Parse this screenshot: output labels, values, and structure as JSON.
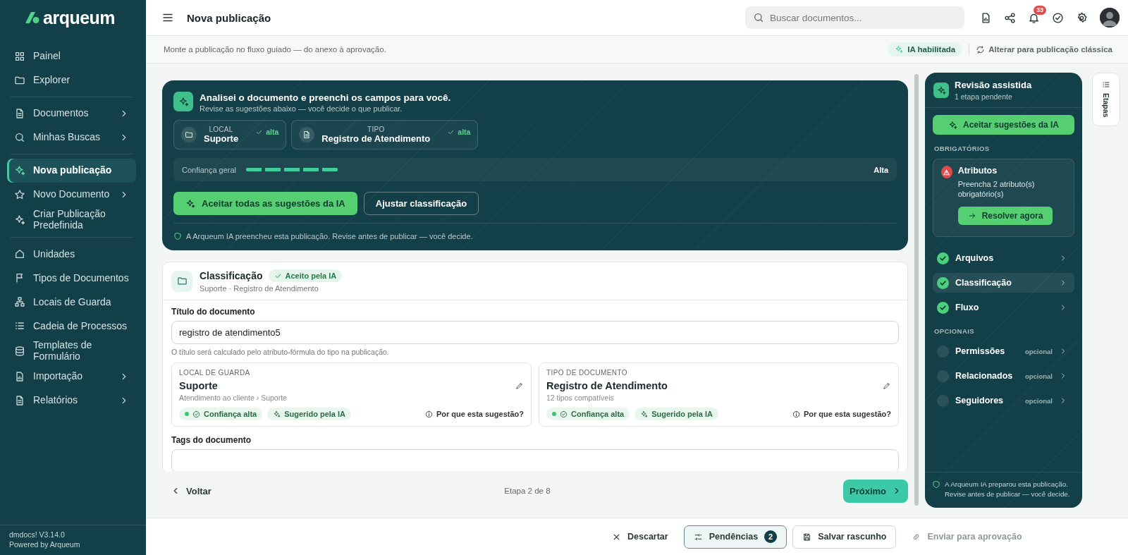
{
  "brand": {
    "name": "arqueum"
  },
  "sidebar": {
    "groups": [
      [
        {
          "label": "Painel",
          "expandable": false,
          "selected": false
        },
        {
          "label": "Explorer",
          "expandable": false,
          "selected": false
        }
      ],
      [
        {
          "label": "Documentos",
          "expandable": true,
          "selected": false
        },
        {
          "label": "Minhas Buscas",
          "expandable": true,
          "selected": false
        }
      ],
      [
        {
          "label": "Nova publicação",
          "expandable": false,
          "selected": true
        },
        {
          "label": "Novo Documento",
          "expandable": true,
          "selected": false
        },
        {
          "label": "Criar Publicação Predefinida",
          "expandable": false,
          "selected": false
        }
      ],
      [
        {
          "label": "Unidades",
          "expandable": false,
          "selected": false
        },
        {
          "label": "Tipos de Documentos",
          "expandable": false,
          "selected": false
        },
        {
          "label": "Locais de Guarda",
          "expandable": false,
          "selected": false
        },
        {
          "label": "Cadeia de Processos",
          "expandable": false,
          "selected": false
        },
        {
          "label": "Templates de Formulário",
          "expandable": false,
          "selected": false
        },
        {
          "label": "Importação",
          "expandable": true,
          "selected": false
        },
        {
          "label": "Relatórios",
          "expandable": true,
          "selected": false
        }
      ]
    ],
    "version": "dmdocs! V3.14.0",
    "powered_by": "Powered by Arqueum"
  },
  "topbar": {
    "title": "Nova publicação",
    "search": {
      "placeholder": "Buscar documentos..."
    },
    "notifications": "33"
  },
  "subbar": {
    "hint": "Monte a publicação no fluxo guiado — do anexo à aprovação.",
    "ai_status": "IA habilitada",
    "switch_link": "Alterar para publicação clássica"
  },
  "hero": {
    "title": "Analisei o documento e preenchi os campos para você.",
    "subtitle": "Revise as sugestões abaixo — você decide o que publicar.",
    "suggestions": [
      {
        "label": "LOCAL",
        "value": "Suporte",
        "confidence": "alta"
      },
      {
        "label": "TIPO",
        "value": "Registro de Atendimento",
        "confidence": "alta"
      }
    ],
    "confidence": {
      "label": "Confiança geral",
      "level": 1,
      "reading": "Alta"
    },
    "buttons": [
      {
        "label": "Aceitar todas as sugestões da IA",
        "kind": "primary"
      },
      {
        "label": "Ajustar classificação",
        "kind": "outline"
      }
    ],
    "note": "A Arqueum IA preencheu esta publicação. Revise antes de publicar — você decide."
  },
  "classification": {
    "title": "Classificação",
    "badge": "Aceito pela IA",
    "subtitle": "Suporte · Registro de Atendimento",
    "title_field": {
      "label": "Título do documento",
      "value": "registro de atendimento5",
      "help": "O título será calculado pelo atributo-fórmula do tipo na publicação."
    },
    "cards": [
      {
        "heading": "LOCAL DE GUARDA",
        "value": "Suporte",
        "detail": "Atendimento ao cliente › Suporte",
        "chips": [
          "Confiança alta",
          "Sugerido pela IA"
        ],
        "why": "Por que esta sugestão?"
      },
      {
        "heading": "TIPO DE DOCUMENTO",
        "value": "Registro de Atendimento",
        "detail": "12 tipos compatíveis",
        "chips": [
          "Confiança alta",
          "Sugerido pela IA"
        ],
        "why": "Por que esta sugestão?"
      }
    ],
    "tags_label": "Tags do documento"
  },
  "nav": {
    "back": "Voltar",
    "step": "Etapa 2 de 8",
    "next": "Próximo"
  },
  "review": {
    "title": "Revisão assistida",
    "subtitle": "1 etapa pendente",
    "accept": "Aceitar sugestões da IA",
    "required_heading": "OBRIGATÓRIOS",
    "alert": {
      "title": "Atributos",
      "text": "Preencha 2 atributo(s) obrigatório(s)",
      "action": "Resolver agora"
    },
    "required": [
      {
        "label": "Arquivos",
        "done": true,
        "selected": false
      },
      {
        "label": "Classificação",
        "done": true,
        "selected": true
      },
      {
        "label": "Fluxo",
        "done": true,
        "selected": false
      }
    ],
    "optional_heading": "OPCIONAIS",
    "optional": [
      {
        "label": "Permissões",
        "tag": "opcional",
        "done": false,
        "selected": false
      },
      {
        "label": "Relacionados",
        "tag": "opcional",
        "done": false,
        "selected": false
      },
      {
        "label": "Seguidores",
        "tag": "opcional",
        "done": false,
        "selected": false
      }
    ],
    "note": "A Arqueum IA preparou esta publicação. Revise antes de publicar — você decide."
  },
  "steps_tab": {
    "label": "Etapas"
  },
  "footer": {
    "buttons": [
      {
        "label": "Descartar",
        "kind": "ghost",
        "disabled": false
      },
      {
        "label": "Pendências",
        "kind": "active",
        "count": "2",
        "disabled": false
      },
      {
        "label": "Salvar rascunho",
        "kind": "outline",
        "disabled": false
      },
      {
        "label": "Enviar para aprovação",
        "kind": "primary",
        "disabled": true
      }
    ]
  }
}
